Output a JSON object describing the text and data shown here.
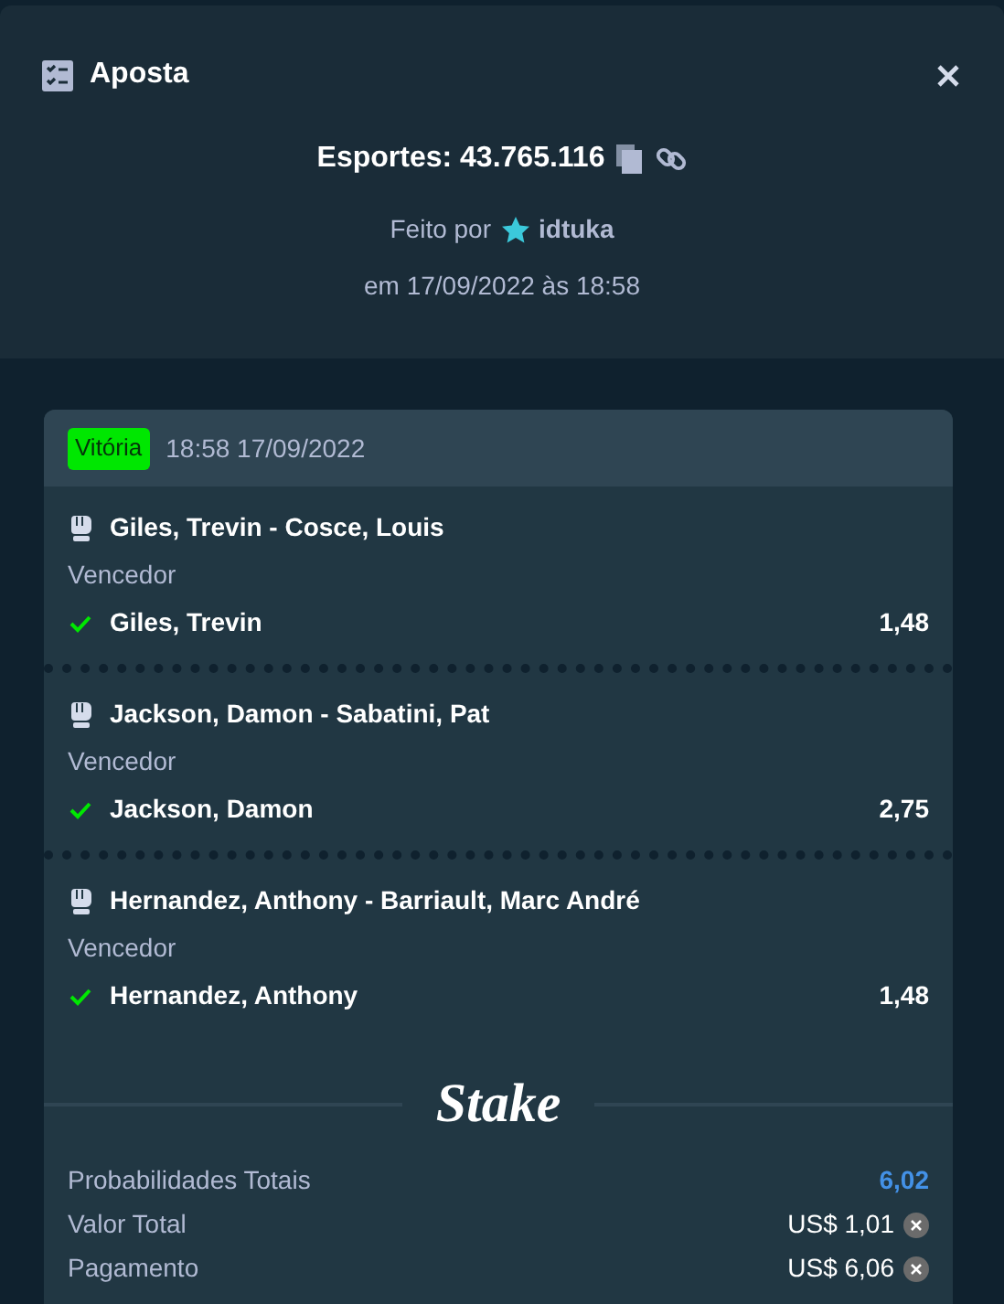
{
  "modal": {
    "title": "Aposta"
  },
  "bet_id": "Esportes: 43.765.116",
  "placed_by": {
    "label": "Feito por",
    "user": "idtuka"
  },
  "placed_at": "em 17/09/2022 às 18:58",
  "ticket": {
    "status": {
      "label": "Vitória",
      "color": "#00e701"
    },
    "datetime": "18:58 17/09/2022",
    "legs": [
      {
        "event": "Giles, Trevin - Cosce, Louis",
        "market": "Vencedor",
        "won": true,
        "selection": "Giles, Trevin",
        "odds": "1,48"
      },
      {
        "event": "Jackson, Damon - Sabatini, Pat",
        "market": "Vencedor",
        "won": true,
        "selection": "Jackson, Damon",
        "odds": "2,75"
      },
      {
        "event": "Hernandez, Anthony - Barriault, Marc André",
        "market": "Vencedor",
        "won": true,
        "selection": "Hernandez, Anthony",
        "odds": "1,48"
      }
    ],
    "logo": "Stake",
    "summary": [
      {
        "label": "Probabilidades Totais",
        "value": "6,02",
        "kind": "odds"
      },
      {
        "label": "Valor Total",
        "value": "US$ 1,01",
        "kind": "money"
      },
      {
        "label": "Pagamento",
        "value": "US$ 6,06",
        "kind": "money"
      }
    ]
  }
}
